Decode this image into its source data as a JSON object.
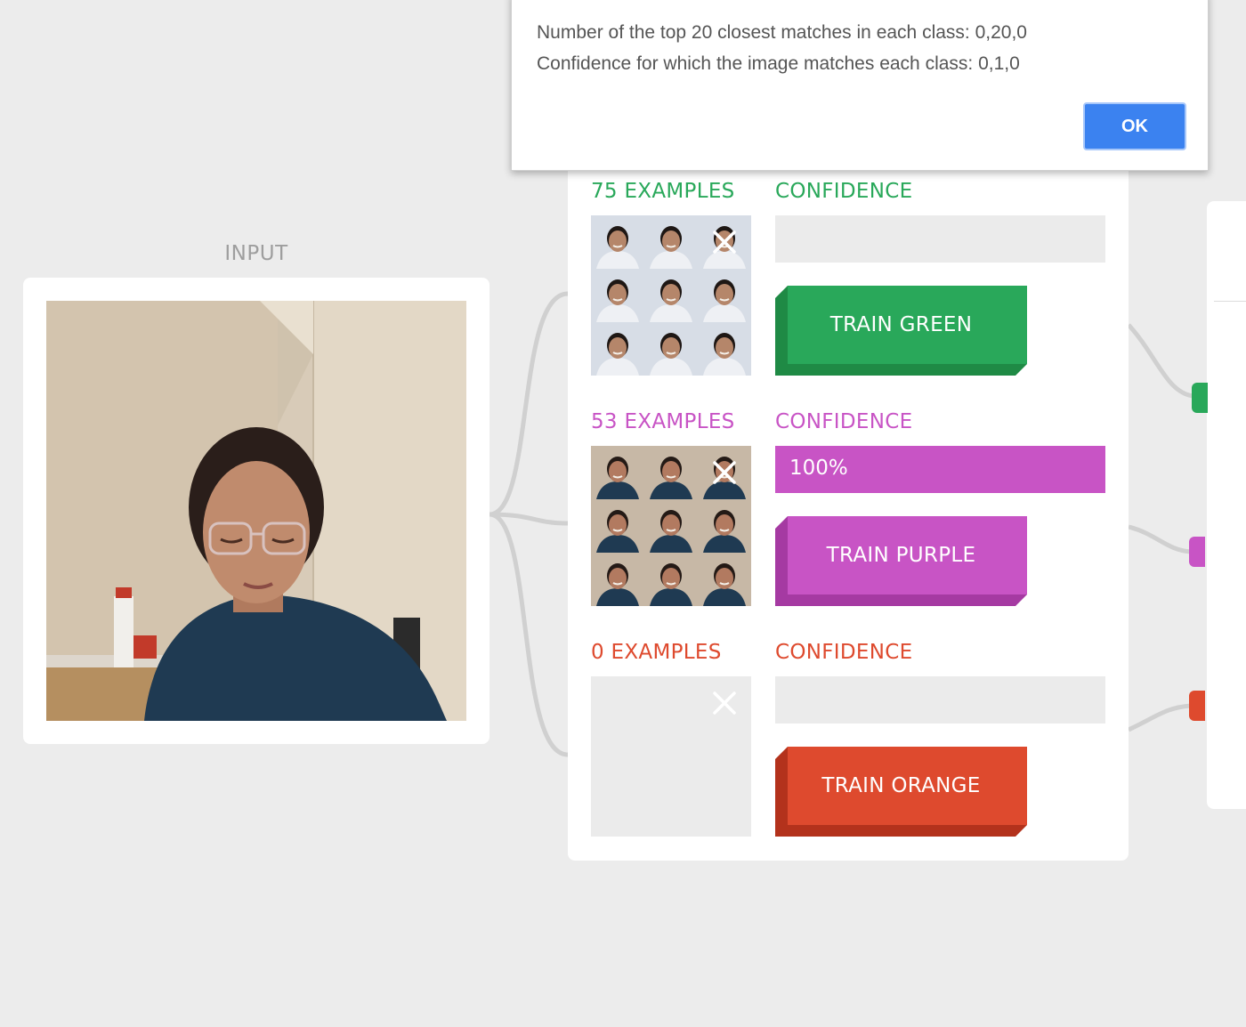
{
  "input": {
    "label": "INPUT"
  },
  "classes": [
    {
      "color": "green",
      "accent": "#29a85a",
      "shade": "#1f8a45",
      "examples_label": "75 EXAMPLES",
      "confidence_label": "CONFIDENCE",
      "confidence_value": "",
      "confidence_fraction": 0,
      "button_label": "TRAIN GREEN",
      "has_examples": true,
      "thumb_palette": "green"
    },
    {
      "color": "purple",
      "accent": "#c854c5",
      "shade": "#a53aa2",
      "examples_label": "53 EXAMPLES",
      "confidence_label": "CONFIDENCE",
      "confidence_value": "100%",
      "confidence_fraction": 1,
      "button_label": "TRAIN PURPLE",
      "has_examples": true,
      "thumb_palette": "purple"
    },
    {
      "color": "orange",
      "accent": "#de4a2e",
      "shade": "#b3321c",
      "examples_label": "0 EXAMPLES",
      "confidence_label": "CONFIDENCE",
      "confidence_value": "",
      "confidence_fraction": 0,
      "button_label": "TRAIN ORANGE",
      "has_examples": false,
      "thumb_palette": "none"
    }
  ],
  "dialog": {
    "line1": "Number of the top 20 closest matches in each class: 0,20,0",
    "line2": "Confidence for which the image matches each class: 0,1,0",
    "ok_label": "OK"
  },
  "icons": {
    "remove_examples": "close-icon"
  }
}
